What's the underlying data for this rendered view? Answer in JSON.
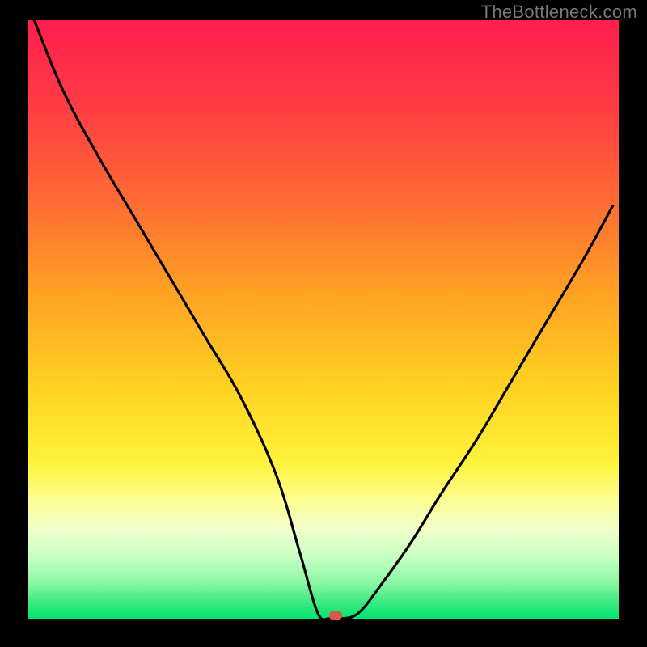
{
  "watermark": "TheBottleneck.com",
  "chart_data": {
    "type": "line",
    "title": "",
    "xlabel": "",
    "ylabel": "",
    "xlim": [
      0,
      100
    ],
    "ylim": [
      0,
      100
    ],
    "grid": false,
    "gradient_stops": [
      {
        "offset": 0,
        "color": "#ff1f4e"
      },
      {
        "offset": 14,
        "color": "#ff3b44"
      },
      {
        "offset": 30,
        "color": "#ff6a34"
      },
      {
        "offset": 46,
        "color": "#ffa324"
      },
      {
        "offset": 62,
        "color": "#ffd421"
      },
      {
        "offset": 74,
        "color": "#fff33b"
      },
      {
        "offset": 80,
        "color": "#fdfe8f"
      },
      {
        "offset": 85,
        "color": "#f2ffcb"
      },
      {
        "offset": 90,
        "color": "#c4ffc1"
      },
      {
        "offset": 94,
        "color": "#8bf8a3"
      },
      {
        "offset": 97,
        "color": "#41eb82"
      },
      {
        "offset": 100,
        "color": "#00e472"
      }
    ],
    "series": [
      {
        "name": "bottleneck-curve",
        "color": "#000000",
        "x": [
          1,
          6,
          12,
          18,
          24,
          30,
          36,
          42,
          46,
          49,
          51,
          53,
          56,
          60,
          65,
          70,
          76,
          82,
          88,
          94,
          99
        ],
        "y": [
          100,
          88,
          77,
          67,
          57,
          47,
          37,
          24,
          11,
          1,
          0,
          0,
          1,
          6,
          13,
          21,
          30,
          40,
          50,
          60,
          69
        ]
      }
    ],
    "marker": {
      "x": 52,
      "y": 0.5,
      "color": "#d65a4a"
    }
  }
}
